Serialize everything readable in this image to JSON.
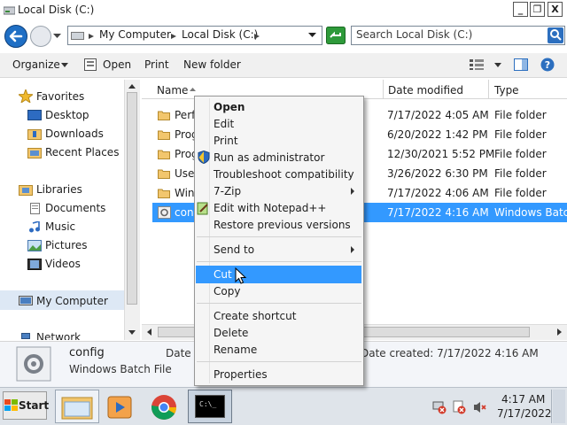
{
  "window": {
    "title": "Local Disk (C:)",
    "minimize_glyph": "_",
    "maximize_glyph": "❐",
    "close_glyph": "X"
  },
  "address": {
    "crumbs": [
      "My Computer",
      "Local Disk (C:)"
    ],
    "search_placeholder": "Search Local Disk (C:)"
  },
  "toolbar": {
    "organize": "Organize",
    "open": "Open",
    "print": "Print",
    "new_folder": "New folder"
  },
  "sidebar": {
    "favorites": "Favorites",
    "desktop": "Desktop",
    "downloads": "Downloads",
    "recent": "Recent Places",
    "libraries": "Libraries",
    "documents": "Documents",
    "music": "Music",
    "pictures": "Pictures",
    "videos": "Videos",
    "computer": "My Computer",
    "network": "Network"
  },
  "columns": {
    "name": "Name",
    "date": "Date modified",
    "type": "Type"
  },
  "files": [
    {
      "name": "Perf",
      "date": "7/17/2022 4:05 AM",
      "type": "File folder"
    },
    {
      "name": "Prog",
      "date": "6/20/2022 1:42 PM",
      "type": "File folder"
    },
    {
      "name": "Prog",
      "date": "12/30/2021 5:52 PM",
      "type": "File folder"
    },
    {
      "name": "Use",
      "date": "3/26/2022 6:30 PM",
      "type": "File folder"
    },
    {
      "name": "Win",
      "date": "7/17/2022 4:06 AM",
      "type": "File folder"
    },
    {
      "name": "con",
      "date": "7/17/2022 4:16 AM",
      "type": "Windows Batch"
    }
  ],
  "details": {
    "name": "config",
    "type": "Windows Batch File",
    "date_label_left": "Date m",
    "date_created": "Date created: 7/17/2022 4:16 AM"
  },
  "context_menu": {
    "open": "Open",
    "edit": "Edit",
    "print": "Print",
    "run_admin": "Run as administrator",
    "troubleshoot": "Troubleshoot compatibility",
    "zip": "7-Zip",
    "notepad": "Edit with Notepad++",
    "restore": "Restore previous versions",
    "send_to": "Send to",
    "cut": "Cut",
    "copy": "Copy",
    "create_shortcut": "Create shortcut",
    "delete": "Delete",
    "rename": "Rename",
    "properties": "Properties"
  },
  "taskbar": {
    "start": "Start",
    "time": "4:17 AM",
    "date": "7/17/2022",
    "cmd_label": "C:\\_"
  },
  "colors": {
    "selection": "#3399ff",
    "menu_highlight": "#3399ff",
    "folder": "#f2c66d"
  }
}
